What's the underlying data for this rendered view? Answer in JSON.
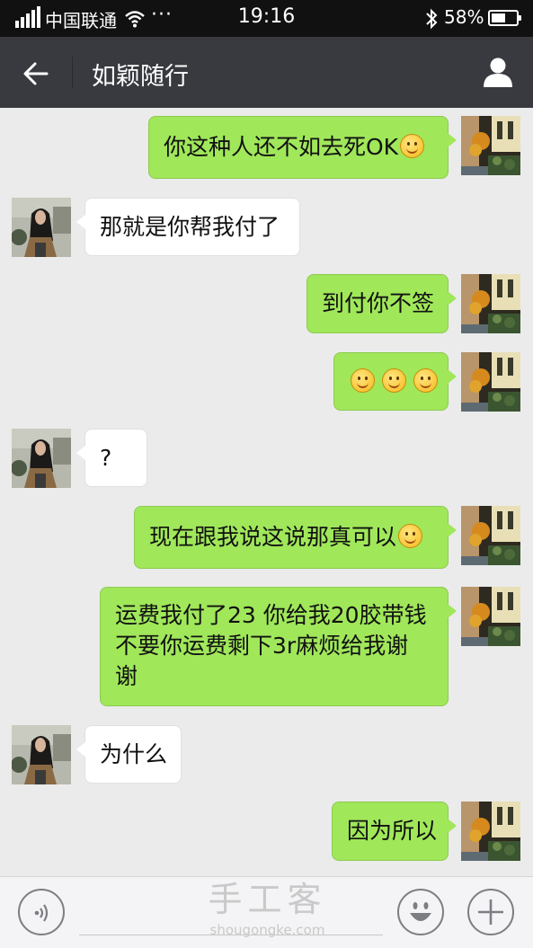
{
  "status_bar": {
    "carrier": "中国联通",
    "extra": "···",
    "time": "19:16",
    "battery_percent": "58%",
    "battery_level": 0.58
  },
  "nav": {
    "title": "如颖随行"
  },
  "messages": [
    {
      "side": "me",
      "text": "你这种人还不如去死OK",
      "emoji_count": 1
    },
    {
      "side": "them",
      "text": "那就是你帮我付了",
      "emoji_count": 0
    },
    {
      "side": "me",
      "text": "到付你不签",
      "emoji_count": 0
    },
    {
      "side": "me",
      "text": "",
      "emoji_count": 3
    },
    {
      "side": "them",
      "text": "?",
      "emoji_count": 0
    },
    {
      "side": "me",
      "text": "现在跟我说这说那真可以",
      "emoji_count": 1
    },
    {
      "side": "me",
      "text": "运费我付了23 你给我20胶带钱\n不要你运费剩下3r麻烦给我谢\n谢",
      "emoji_count": 0
    },
    {
      "side": "them",
      "text": "为什么",
      "emoji_count": 0
    },
    {
      "side": "me",
      "text": "因为所以",
      "emoji_count": 0
    }
  ],
  "icons": {
    "back": "arrow-left-icon",
    "profile": "user-icon",
    "voice": "voice-icon",
    "emoji": "emoji-icon",
    "more": "plus-icon",
    "smiley": "smiley-emoji-icon"
  },
  "colors": {
    "status_bar": "#111111",
    "nav_bar": "#393a3f",
    "chat_background": "#ebebeb",
    "my_bubble": "#a0e75a",
    "their_bubble": "#ffffff"
  },
  "watermark": {
    "title": "手工客",
    "url": "shougongke.com"
  }
}
